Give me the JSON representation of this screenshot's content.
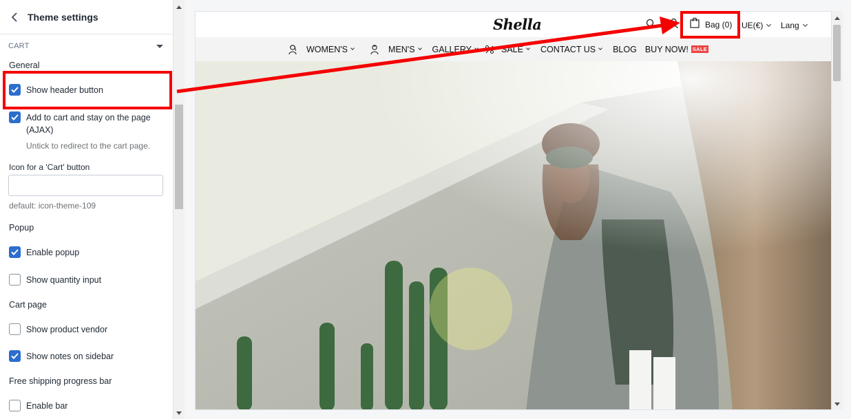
{
  "panel": {
    "title": "Theme settings",
    "section": "CART",
    "general_heading": "General",
    "show_header_button": {
      "label": "Show header button",
      "checked": true
    },
    "ajax": {
      "label": "Add to cart and stay on the page (AJAX)",
      "checked": true,
      "help": "Untick to redirect to the cart page."
    },
    "icon_field": {
      "label": "Icon for a 'Cart' button",
      "value": "",
      "default_text": "default: icon-theme-109"
    },
    "popup_heading": "Popup",
    "enable_popup": {
      "label": "Enable popup",
      "checked": true
    },
    "show_quantity_input": {
      "label": "Show quantity input",
      "checked": false
    },
    "cart_page_heading": "Cart page",
    "show_product_vendor": {
      "label": "Show product vendor",
      "checked": false
    },
    "show_notes_on_sidebar": {
      "label": "Show notes on sidebar",
      "checked": true
    },
    "free_shipping_heading": "Free shipping progress bar",
    "enable_bar": {
      "label": "Enable bar",
      "checked": false
    }
  },
  "preview": {
    "logo": "Shella",
    "bag_label": "Bag (0)",
    "currency": "UE(€)",
    "lang": "Lang",
    "nav": {
      "womens": "WOMEN'S",
      "mens": "MEN'S",
      "gallery": "GALLERY",
      "sale": "SALE",
      "contact": "CONTACT US",
      "blog": "BLOG",
      "buy_now": "BUY NOW!",
      "sale_badge": "SALE"
    }
  },
  "colors": {
    "checkbox_accent": "#2c6ecb",
    "annotation_red": "#f50000",
    "sale_badge": "#ee4444"
  }
}
